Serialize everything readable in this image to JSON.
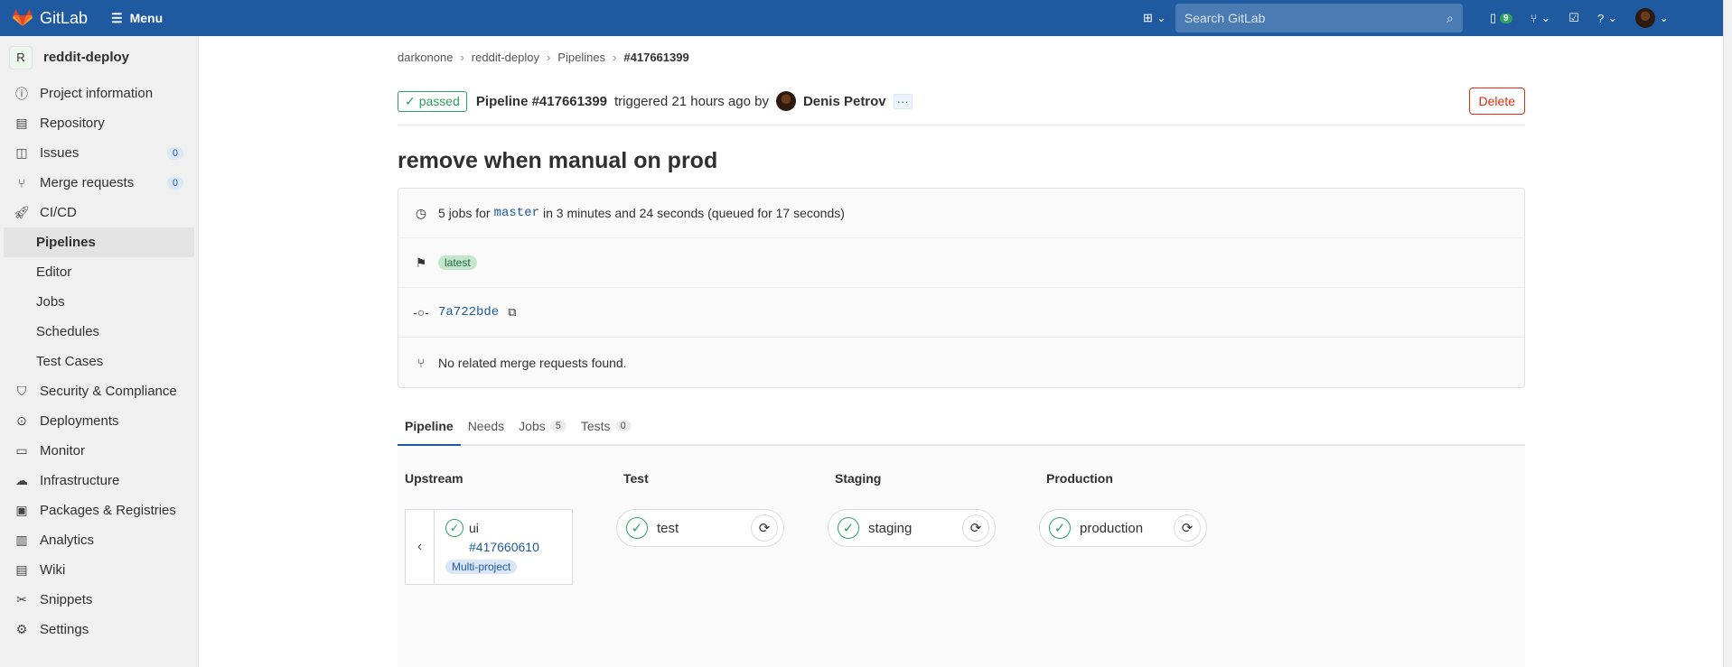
{
  "topbar": {
    "logo_text": "GitLab",
    "menu_label": "Menu",
    "search_placeholder": "Search GitLab",
    "issues_count": "9"
  },
  "sidebar": {
    "project_initial": "R",
    "project_name": "reddit-deploy",
    "items": [
      {
        "label": "Project information",
        "icon": "info-icon"
      },
      {
        "label": "Repository",
        "icon": "book-icon"
      },
      {
        "label": "Issues",
        "icon": "issues-icon",
        "count": "0"
      },
      {
        "label": "Merge requests",
        "icon": "merge-request-icon",
        "count": "0"
      },
      {
        "label": "CI/CD",
        "icon": "rocket-icon"
      },
      {
        "label": "Pipelines"
      },
      {
        "label": "Editor"
      },
      {
        "label": "Jobs"
      },
      {
        "label": "Schedules"
      },
      {
        "label": "Test Cases"
      },
      {
        "label": "Security & Compliance",
        "icon": "shield-icon"
      },
      {
        "label": "Deployments",
        "icon": "deployments-icon"
      },
      {
        "label": "Monitor",
        "icon": "monitor-icon"
      },
      {
        "label": "Infrastructure",
        "icon": "cloud-icon"
      },
      {
        "label": "Packages & Registries",
        "icon": "package-icon"
      },
      {
        "label": "Analytics",
        "icon": "chart-icon"
      },
      {
        "label": "Wiki",
        "icon": "book-icon"
      },
      {
        "label": "Snippets",
        "icon": "snippet-icon"
      },
      {
        "label": "Settings",
        "icon": "gear-icon"
      }
    ]
  },
  "breadcrumb": [
    "darkonone",
    "reddit-deploy",
    "Pipelines",
    "#417661399"
  ],
  "pipeline": {
    "status": "passed",
    "id_label": "Pipeline #417661399",
    "triggered_text": "triggered 21 hours ago by",
    "author": "Denis Petrov",
    "delete_label": "Delete",
    "title": "remove when manual on prod",
    "jobs_prefix": "5 jobs for",
    "branch": "master",
    "jobs_suffix": "in 3 minutes and 24 seconds (queued for 17 seconds)",
    "tag": "latest",
    "commit_sha": "7a722bde",
    "mr_text": "No related merge requests found."
  },
  "tabs": [
    {
      "label": "Pipeline",
      "count": ""
    },
    {
      "label": "Needs",
      "count": ""
    },
    {
      "label": "Jobs",
      "count": "5"
    },
    {
      "label": "Tests",
      "count": "0"
    }
  ],
  "graph": {
    "stages": [
      "Upstream",
      "Test",
      "Staging",
      "Production"
    ],
    "upstream": {
      "name": "ui",
      "pipeline": "#417660610",
      "badge": "Multi-project"
    },
    "jobs": [
      "test",
      "staging",
      "production"
    ]
  },
  "colors": {
    "header": "#1f5aa0",
    "success": "#2da160",
    "danger": "#dd2b0e",
    "link": "#1f5aa0"
  }
}
